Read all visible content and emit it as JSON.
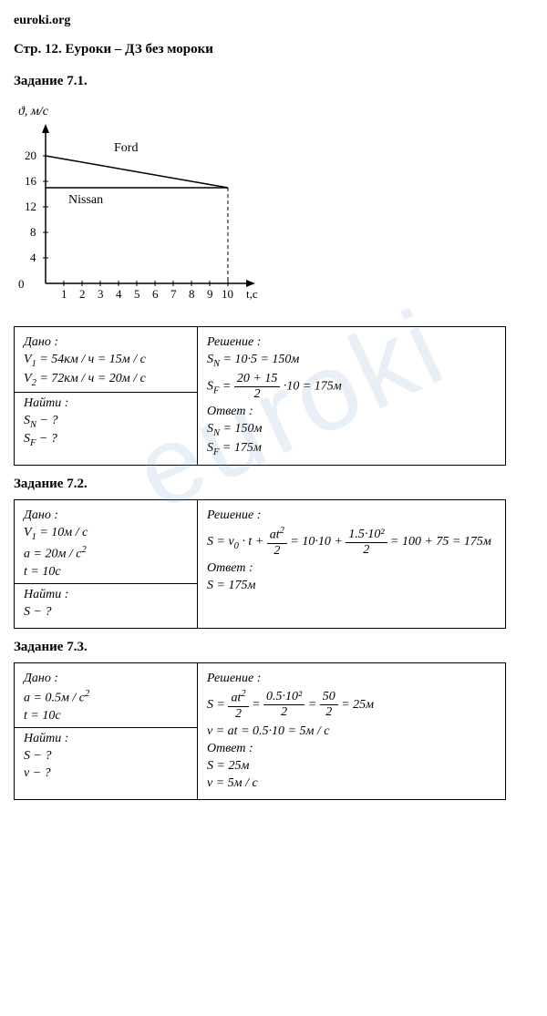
{
  "site": "euroki.org",
  "page_title": "Стр. 12. Еуроки – ДЗ без мороки",
  "watermark": "euroki",
  "tasks": {
    "t71": {
      "title": "Задание 7.1.",
      "given_label": "Дано :",
      "given_v1": "V₁ = 54км / ч = 15м / с",
      "given_v2": "V₂ = 72км / ч = 20м / с",
      "find_label": "Найти :",
      "find_sn": "Sₙ − ?",
      "find_sf": "S_F − ?",
      "solution_label": "Решение :",
      "sol_sn": "Sₙ = 10·5 = 150м",
      "sol_sf_lhs": "S_F =",
      "sol_sf_num": "20 + 15",
      "sol_sf_den": "2",
      "sol_sf_rhs": "·10 = 175м",
      "answer_label": "Ответ :",
      "ans_sn": "Sₙ = 150м",
      "ans_sf": "S_F = 175м"
    },
    "t72": {
      "title": "Задание 7.2.",
      "given_label": "Дано :",
      "given_v1": "V₁ = 10м / с",
      "given_a": "a = 20м / с²",
      "given_t": "t = 10c",
      "find_label": "Найти :",
      "find_s": "S − ?",
      "solution_label": "Решение :",
      "sol_lhs": "S = v₀ · t +",
      "sol_num1": "at²",
      "sol_den1": "2",
      "sol_mid": "= 10·10 +",
      "sol_num2": "1.5·10²",
      "sol_den2": "2",
      "sol_rhs": "= 100 + 75 = 175м",
      "answer_label": "Ответ :",
      "ans_s": "S = 175м"
    },
    "t73": {
      "title": "Задание 7.3.",
      "given_label": "Дано :",
      "given_a": "a = 0.5м / с²",
      "given_t": "t = 10c",
      "find_label": "Найти :",
      "find_s": "S − ?",
      "find_v": "v − ?",
      "solution_label": "Решение :",
      "sol_s_lhs": "S =",
      "sol_s_num1": "at²",
      "sol_s_den1": "2",
      "sol_s_eq1": "=",
      "sol_s_num2": "0.5·10²",
      "sol_s_den2": "2",
      "sol_s_eq2": "=",
      "sol_s_num3": "50",
      "sol_s_den3": "2",
      "sol_s_rhs": "= 25м",
      "sol_v": "v = at = 0.5·10 = 5м / с",
      "answer_label": "Ответ :",
      "ans_s": "S = 25м",
      "ans_v": "v = 5м / с"
    }
  },
  "chart_data": {
    "type": "line",
    "title": "",
    "xlabel": "t,с",
    "ylabel": "ϑ, м/с",
    "xlim": [
      0,
      10
    ],
    "ylim": [
      0,
      20
    ],
    "x_ticks": [
      1,
      2,
      3,
      4,
      5,
      6,
      7,
      8,
      9,
      10
    ],
    "y_ticks": [
      4,
      8,
      12,
      16,
      20
    ],
    "series": [
      {
        "name": "Ford",
        "x": [
          0,
          10
        ],
        "y": [
          20,
          15
        ]
      },
      {
        "name": "Nissan",
        "x": [
          0,
          10
        ],
        "y": [
          15,
          15
        ]
      }
    ],
    "vertical_guide_at_x": 10
  }
}
